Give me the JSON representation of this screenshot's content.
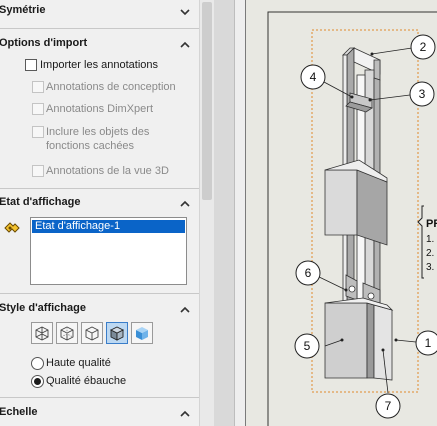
{
  "sections": {
    "symetrie": {
      "title": "Symétrie"
    },
    "options_import": {
      "title": "Options d'import",
      "importer_annotations": "Importer les annotations",
      "annotations_conception": "Annotations de conception",
      "annotations_dimxpert": "Annotations DimXpert",
      "objets_caches_line1": "Inclure les objets des",
      "objets_caches_line2": "fonctions cachées",
      "annotations_vue3d": "Annotations de la vue 3D"
    },
    "etat_affichage": {
      "title": "Etat d'affichage",
      "items": [
        "Etat d'affichage-1"
      ]
    },
    "style_affichage": {
      "title": "Style d'affichage",
      "buttons": [
        "wireframe-icon",
        "hidden-lines-visible-icon",
        "hidden-lines-removed-icon",
        "shaded-with-edges-icon",
        "shaded-icon"
      ],
      "haute_qualite": "Haute qualité",
      "qualite_ebauche": "Qualité ébauche",
      "selected_quality": "Qualité ébauche"
    },
    "echelle": {
      "title": "Echelle"
    }
  },
  "drawing": {
    "balloons": [
      "1",
      "2",
      "3",
      "4",
      "5",
      "6",
      "7"
    ],
    "parts_list_header": "PR",
    "parts_list_rows": [
      "1.",
      "2.",
      "3."
    ]
  },
  "colors": {
    "accent": "#0a64c8",
    "bbox": "#e08a2c",
    "sheet": "#e8e8e2"
  }
}
